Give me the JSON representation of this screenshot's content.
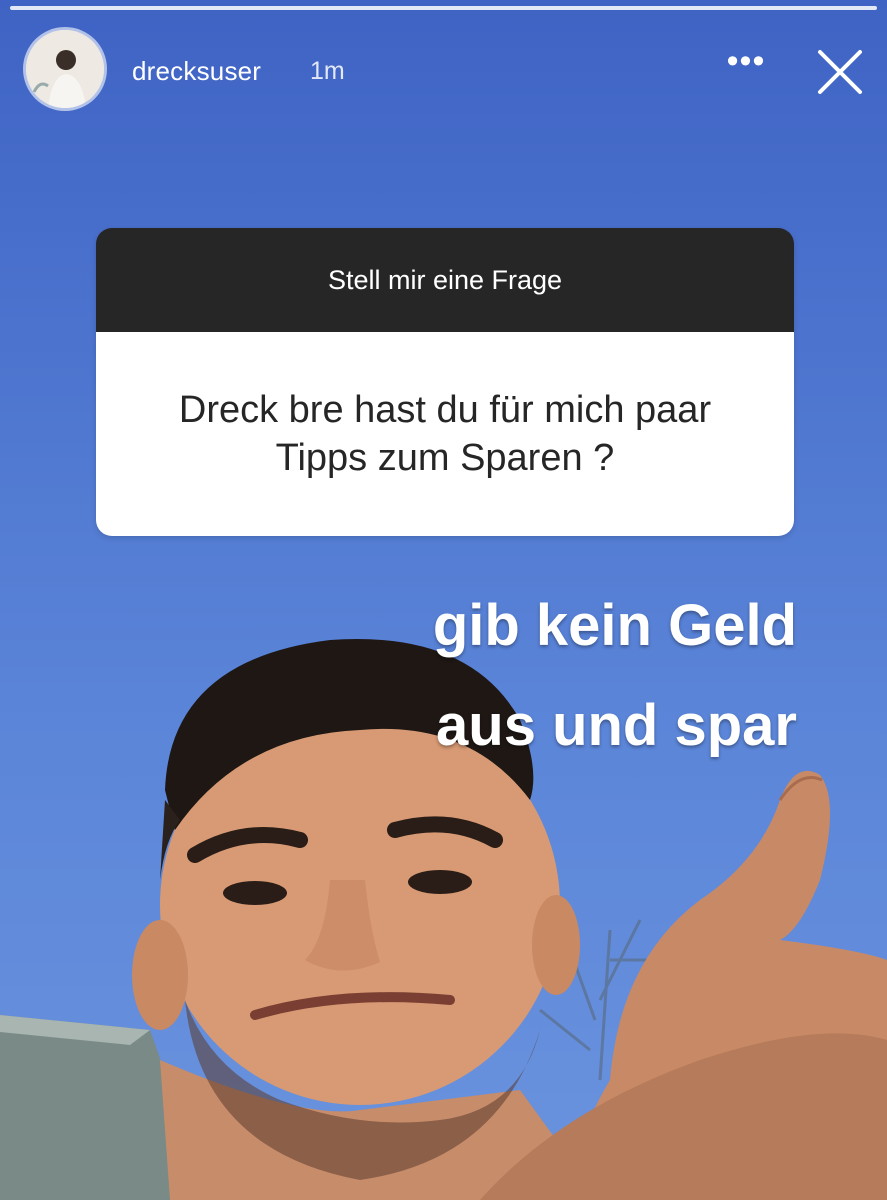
{
  "story": {
    "progress_segments": 1,
    "header": {
      "username": "drecksuser",
      "time": "1m",
      "more_icon": "more-horizontal-icon",
      "close_icon": "close-icon"
    },
    "question_sticker": {
      "title": "Stell mir eine Frage",
      "question": "Dreck bre hast du für mich paar\nTipps zum Sparen ?"
    },
    "answer_text": "gib kein Geld\naus und spar"
  },
  "colors": {
    "sky": "#4a70c9",
    "sticker_header": "#262626",
    "sticker_body": "#ffffff",
    "text_on_photo": "#ffffff"
  }
}
